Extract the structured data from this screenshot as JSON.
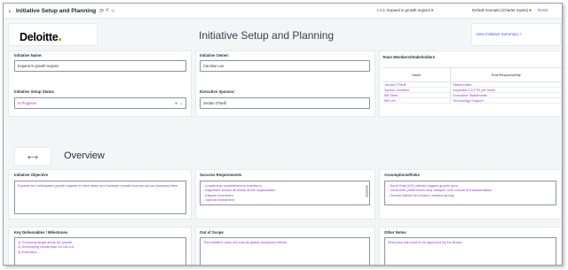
{
  "topbar": {
    "back_icon": "chevron-left-icon",
    "title": "Initiative Setup and Planning",
    "icons": [
      "sync-icon",
      "share-icon",
      "star-icon"
    ],
    "initiative_select": "I.A.1: Expand in growth regions",
    "scenario_select": "Default Scenario (Charter Inputs)",
    "reset": "Reset"
  },
  "header": {
    "logo": "Deloitte",
    "title": "Initiative Setup and Planning",
    "summary_link": "View Initiative Summary >"
  },
  "form": {
    "name_label": "Initiative Name:",
    "name_value": "Expand in growth regions",
    "owner_label": "Initiative Owner:",
    "owner_value": "Caroline Lee",
    "status_label": "Initiative Setup Status",
    "status_value": "In Progress",
    "sponsor_label": "Executive Sponsor:",
    "sponsor_value": "Jordan O'Neill"
  },
  "team": {
    "title": "Team Members/Stakeholders",
    "columns": [
      "Name",
      "Role/Responsibility"
    ],
    "rows": [
      {
        "name": "Jordan O'Neill",
        "role": "Stakeholder"
      },
      {
        "name": "Sydnor Gardiner",
        "role": "expected 0.5 FTE per week"
      },
      {
        "name": "Bill Shen",
        "role": "Executive Stakeholder"
      },
      {
        "name": "Bill Lee",
        "role": "Technology Support"
      }
    ]
  },
  "overview": {
    "move_icon": "move-icon",
    "title": "Overview",
    "objective_label": "Initiative Objective",
    "objective_text": "Expand into anticipated growth regions to drive sales and increase overall revenue across business lines",
    "success_label": "Success Requirements",
    "success_items": [
      "- Leadership commitment to transform",
      "- Alignment across all levels of the organization",
      "- Aligned incentives",
      "- Upfront investment"
    ],
    "assumptions_label": "Assumptions/Risks",
    "assumptions_items": [
      "- North East (US) reflects biggest growth area",
      "- Consumer preferences may dampen over course of transformation",
      "- Overall market for product remains strong"
    ],
    "deliverables_label": "Key Deliverables / Milestones",
    "deliverables_items": [
      "1) Choosing target areas for growth",
      "2) Developing robust plan for roll out",
      "3) Execution"
    ],
    "scope_label": "Out of Scope",
    "scope_text": "This initiative does not include global expansion efforts",
    "notes_label": "Other Notes",
    "notes_text": "Final plan will need to be approved by the Board"
  }
}
